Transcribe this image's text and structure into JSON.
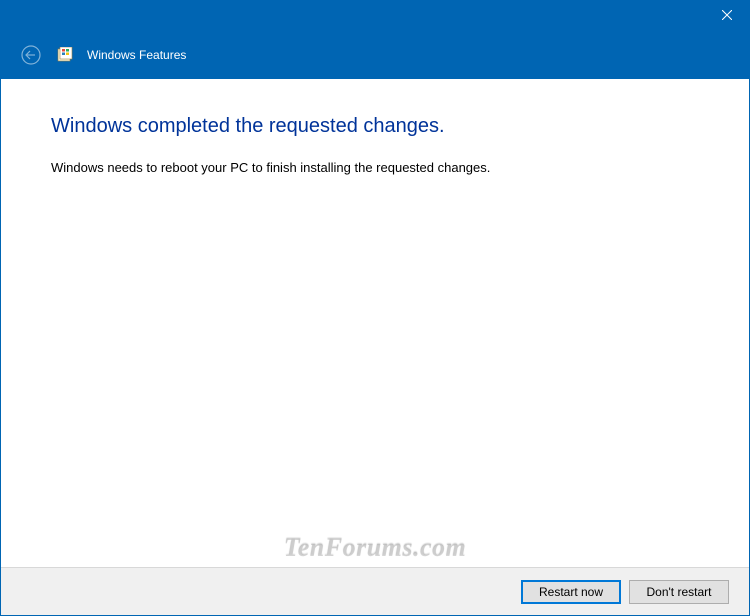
{
  "header": {
    "title": "Windows Features"
  },
  "content": {
    "heading": "Windows completed the requested changes.",
    "body": "Windows needs to reboot your PC to finish installing the requested changes."
  },
  "footer": {
    "primary_button": "Restart now",
    "secondary_button": "Don't restart"
  },
  "watermark": "TenForums.com"
}
